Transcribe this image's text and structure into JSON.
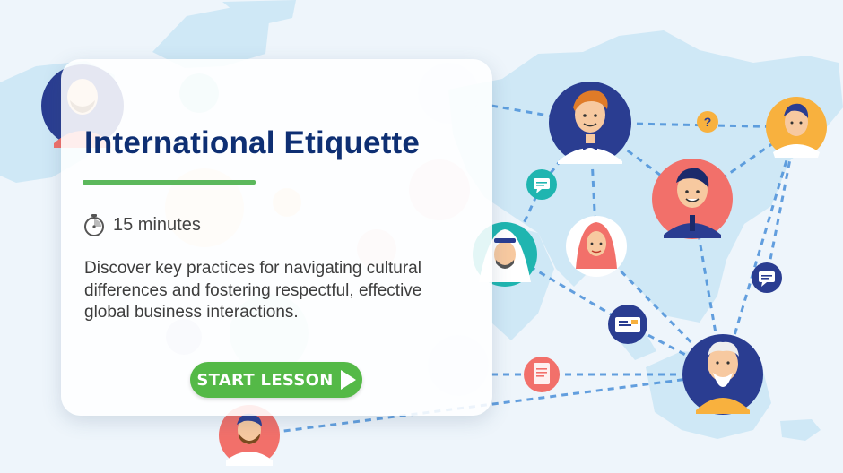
{
  "lesson": {
    "title": "International Etiquette",
    "duration": "15 minutes",
    "description": "Discover key practices for navigating cultural differences and fostering respectful, effective global business interactions.",
    "start_label": "START LESSON"
  },
  "icons": {
    "duration": "stopwatch-icon",
    "start": "play-icon",
    "question": "question-mark-icon",
    "chat": "chat-bubble-icon",
    "card": "business-card-icon",
    "document": "document-icon"
  },
  "background": {
    "question_symbol": "?"
  },
  "colors": {
    "title": "#0e2f73",
    "accent_green": "#54b947",
    "underline_green": "#5cb85c",
    "background": "#eef5fb",
    "map": "#cfe8f6",
    "connector": "#4a90d9",
    "avatar_navy": "#2a3d91",
    "avatar_coral": "#f2706a",
    "avatar_orange": "#f8b13e",
    "avatar_teal": "#1fb5b0"
  }
}
